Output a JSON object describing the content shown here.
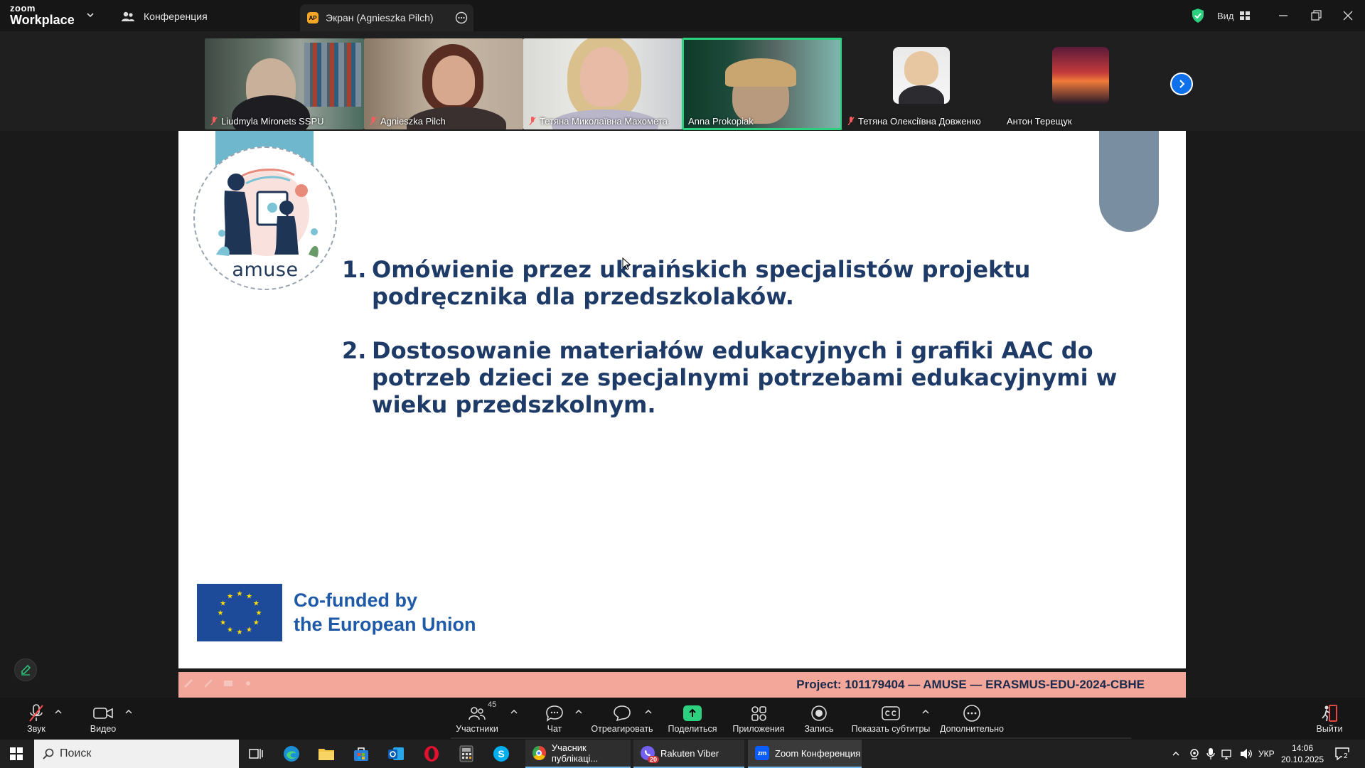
{
  "app": {
    "logo_top": "zoom",
    "logo_bottom": "Workplace"
  },
  "titlebar": {
    "tabs": [
      {
        "label": "Конференция"
      },
      {
        "label": "Экран (Agnieszka Pilch)",
        "badge": "AP"
      }
    ],
    "view_label": "Вид"
  },
  "gallery": {
    "participants": [
      {
        "name": "Liudmyla Mironets SSPU",
        "muted": true
      },
      {
        "name": "Agnieszka Pilch",
        "muted": true
      },
      {
        "name": "Тетяна Миколаївна Махомета",
        "muted": true
      },
      {
        "name": "Anna Prokopiak",
        "muted": false,
        "active": true
      },
      {
        "name": "Тетяна Олексіївна Довженко",
        "muted": true
      },
      {
        "name": "Антон Терещук",
        "muted": false
      }
    ]
  },
  "slide": {
    "logo_text": "amuse",
    "items": [
      {
        "num": "1.",
        "text": "Omówienie przez ukraińskich specjalistów projektu podręcznika dla przedszkolaków."
      },
      {
        "num": "2.",
        "text": "Dostosowanie materiałów edukacyjnych i grafiki AAC do potrzeb dzieci ze specjalnymi potrzebami edukacyjnymi w wieku przedszkolnym."
      }
    ],
    "eu_line1": "Co-funded by",
    "eu_line2": "the European Union",
    "footer": "Project: 101179404 — AMUSE — ERASMUS-EDU-2024-CBHE"
  },
  "toolbar": {
    "audio": "Звук",
    "video": "Видео",
    "participants": "Участники",
    "participants_count": "45",
    "chat": "Чат",
    "react": "Отреагировать",
    "share": "Поделиться",
    "apps": "Приложения",
    "record": "Запись",
    "captions": "Показать субтитры",
    "more": "Дополнительно",
    "leave": "Выйти"
  },
  "taskbar": {
    "search_placeholder": "Поиск",
    "apps": [
      {
        "label": "Учасник публікаці...",
        "icon": "chrome-icon"
      },
      {
        "label": "Rakuten Viber",
        "icon": "viber-icon",
        "badge": "20"
      },
      {
        "label": "Zoom Конференция",
        "icon": "zoom-icon"
      }
    ],
    "language": "УКР",
    "time": "14:06",
    "date": "20.10.2025",
    "notifications": "2"
  },
  "colors": {
    "active_speaker": "#2bd17e",
    "slide_text": "#1e3a66",
    "eu_blue": "#1e5aa8",
    "footer_bg": "#f2a79a",
    "accent_blue": "#0e71eb"
  }
}
